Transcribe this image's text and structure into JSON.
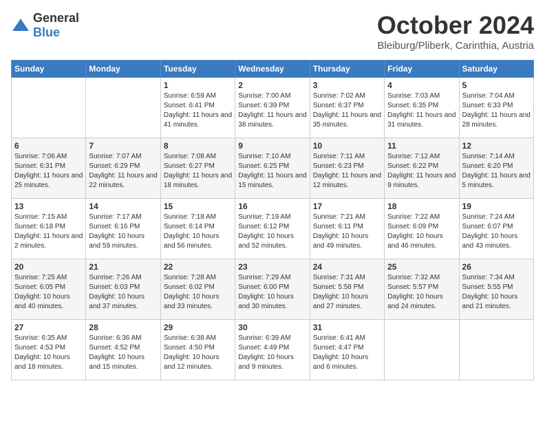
{
  "header": {
    "logo_general": "General",
    "logo_blue": "Blue",
    "month_title": "October 2024",
    "location": "Bleiburg/Pliberk, Carinthia, Austria"
  },
  "days_of_week": [
    "Sunday",
    "Monday",
    "Tuesday",
    "Wednesday",
    "Thursday",
    "Friday",
    "Saturday"
  ],
  "weeks": [
    [
      {
        "day": "",
        "sunrise": "",
        "sunset": "",
        "daylight": ""
      },
      {
        "day": "",
        "sunrise": "",
        "sunset": "",
        "daylight": ""
      },
      {
        "day": "1",
        "sunrise": "Sunrise: 6:59 AM",
        "sunset": "Sunset: 6:41 PM",
        "daylight": "Daylight: 11 hours and 41 minutes."
      },
      {
        "day": "2",
        "sunrise": "Sunrise: 7:00 AM",
        "sunset": "Sunset: 6:39 PM",
        "daylight": "Daylight: 11 hours and 38 minutes."
      },
      {
        "day": "3",
        "sunrise": "Sunrise: 7:02 AM",
        "sunset": "Sunset: 6:37 PM",
        "daylight": "Daylight: 11 hours and 35 minutes."
      },
      {
        "day": "4",
        "sunrise": "Sunrise: 7:03 AM",
        "sunset": "Sunset: 6:35 PM",
        "daylight": "Daylight: 11 hours and 31 minutes."
      },
      {
        "day": "5",
        "sunrise": "Sunrise: 7:04 AM",
        "sunset": "Sunset: 6:33 PM",
        "daylight": "Daylight: 11 hours and 28 minutes."
      }
    ],
    [
      {
        "day": "6",
        "sunrise": "Sunrise: 7:06 AM",
        "sunset": "Sunset: 6:31 PM",
        "daylight": "Daylight: 11 hours and 25 minutes."
      },
      {
        "day": "7",
        "sunrise": "Sunrise: 7:07 AM",
        "sunset": "Sunset: 6:29 PM",
        "daylight": "Daylight: 11 hours and 22 minutes."
      },
      {
        "day": "8",
        "sunrise": "Sunrise: 7:08 AM",
        "sunset": "Sunset: 6:27 PM",
        "daylight": "Daylight: 11 hours and 18 minutes."
      },
      {
        "day": "9",
        "sunrise": "Sunrise: 7:10 AM",
        "sunset": "Sunset: 6:25 PM",
        "daylight": "Daylight: 11 hours and 15 minutes."
      },
      {
        "day": "10",
        "sunrise": "Sunrise: 7:11 AM",
        "sunset": "Sunset: 6:23 PM",
        "daylight": "Daylight: 11 hours and 12 minutes."
      },
      {
        "day": "11",
        "sunrise": "Sunrise: 7:12 AM",
        "sunset": "Sunset: 6:22 PM",
        "daylight": "Daylight: 11 hours and 9 minutes."
      },
      {
        "day": "12",
        "sunrise": "Sunrise: 7:14 AM",
        "sunset": "Sunset: 6:20 PM",
        "daylight": "Daylight: 11 hours and 5 minutes."
      }
    ],
    [
      {
        "day": "13",
        "sunrise": "Sunrise: 7:15 AM",
        "sunset": "Sunset: 6:18 PM",
        "daylight": "Daylight: 11 hours and 2 minutes."
      },
      {
        "day": "14",
        "sunrise": "Sunrise: 7:17 AM",
        "sunset": "Sunset: 6:16 PM",
        "daylight": "Daylight: 10 hours and 59 minutes."
      },
      {
        "day": "15",
        "sunrise": "Sunrise: 7:18 AM",
        "sunset": "Sunset: 6:14 PM",
        "daylight": "Daylight: 10 hours and 56 minutes."
      },
      {
        "day": "16",
        "sunrise": "Sunrise: 7:19 AM",
        "sunset": "Sunset: 6:12 PM",
        "daylight": "Daylight: 10 hours and 52 minutes."
      },
      {
        "day": "17",
        "sunrise": "Sunrise: 7:21 AM",
        "sunset": "Sunset: 6:11 PM",
        "daylight": "Daylight: 10 hours and 49 minutes."
      },
      {
        "day": "18",
        "sunrise": "Sunrise: 7:22 AM",
        "sunset": "Sunset: 6:09 PM",
        "daylight": "Daylight: 10 hours and 46 minutes."
      },
      {
        "day": "19",
        "sunrise": "Sunrise: 7:24 AM",
        "sunset": "Sunset: 6:07 PM",
        "daylight": "Daylight: 10 hours and 43 minutes."
      }
    ],
    [
      {
        "day": "20",
        "sunrise": "Sunrise: 7:25 AM",
        "sunset": "Sunset: 6:05 PM",
        "daylight": "Daylight: 10 hours and 40 minutes."
      },
      {
        "day": "21",
        "sunrise": "Sunrise: 7:26 AM",
        "sunset": "Sunset: 6:03 PM",
        "daylight": "Daylight: 10 hours and 37 minutes."
      },
      {
        "day": "22",
        "sunrise": "Sunrise: 7:28 AM",
        "sunset": "Sunset: 6:02 PM",
        "daylight": "Daylight: 10 hours and 33 minutes."
      },
      {
        "day": "23",
        "sunrise": "Sunrise: 7:29 AM",
        "sunset": "Sunset: 6:00 PM",
        "daylight": "Daylight: 10 hours and 30 minutes."
      },
      {
        "day": "24",
        "sunrise": "Sunrise: 7:31 AM",
        "sunset": "Sunset: 5:58 PM",
        "daylight": "Daylight: 10 hours and 27 minutes."
      },
      {
        "day": "25",
        "sunrise": "Sunrise: 7:32 AM",
        "sunset": "Sunset: 5:57 PM",
        "daylight": "Daylight: 10 hours and 24 minutes."
      },
      {
        "day": "26",
        "sunrise": "Sunrise: 7:34 AM",
        "sunset": "Sunset: 5:55 PM",
        "daylight": "Daylight: 10 hours and 21 minutes."
      }
    ],
    [
      {
        "day": "27",
        "sunrise": "Sunrise: 6:35 AM",
        "sunset": "Sunset: 4:53 PM",
        "daylight": "Daylight: 10 hours and 18 minutes."
      },
      {
        "day": "28",
        "sunrise": "Sunrise: 6:36 AM",
        "sunset": "Sunset: 4:52 PM",
        "daylight": "Daylight: 10 hours and 15 minutes."
      },
      {
        "day": "29",
        "sunrise": "Sunrise: 6:38 AM",
        "sunset": "Sunset: 4:50 PM",
        "daylight": "Daylight: 10 hours and 12 minutes."
      },
      {
        "day": "30",
        "sunrise": "Sunrise: 6:39 AM",
        "sunset": "Sunset: 4:49 PM",
        "daylight": "Daylight: 10 hours and 9 minutes."
      },
      {
        "day": "31",
        "sunrise": "Sunrise: 6:41 AM",
        "sunset": "Sunset: 4:47 PM",
        "daylight": "Daylight: 10 hours and 6 minutes."
      },
      {
        "day": "",
        "sunrise": "",
        "sunset": "",
        "daylight": ""
      },
      {
        "day": "",
        "sunrise": "",
        "sunset": "",
        "daylight": ""
      }
    ]
  ]
}
